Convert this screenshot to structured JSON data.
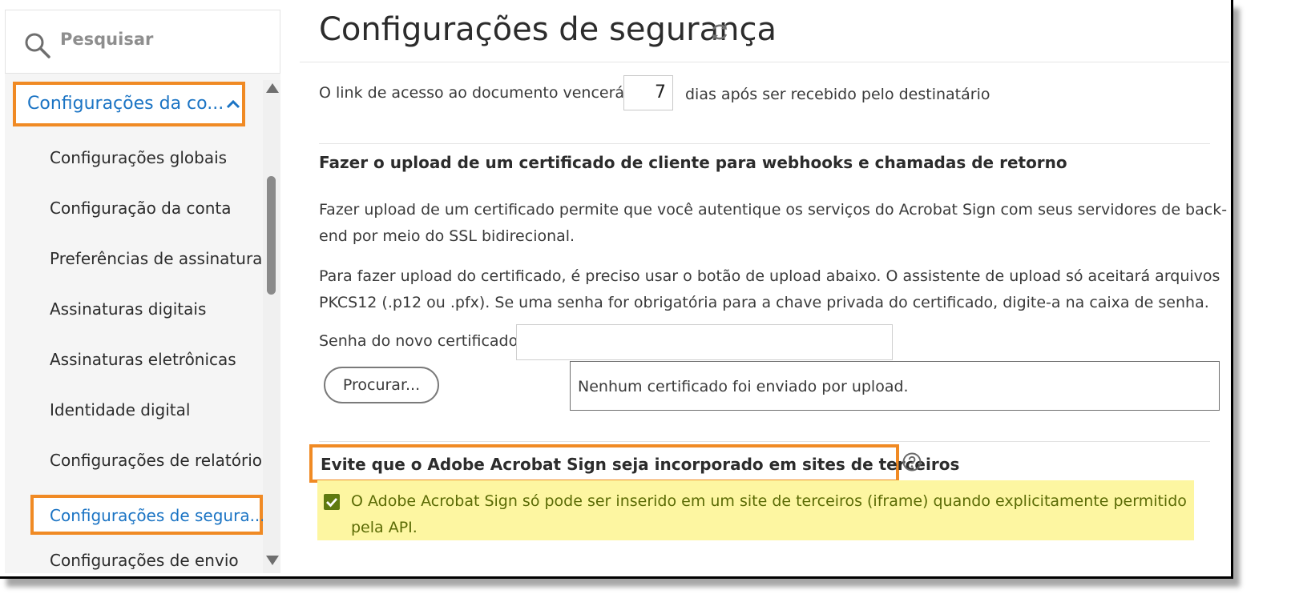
{
  "search": {
    "placeholder": "Pesquisar"
  },
  "sidebar": {
    "group_label": "Configurações da co...",
    "items": [
      {
        "label": "Configurações globais"
      },
      {
        "label": "Configuração da conta"
      },
      {
        "label": "Preferências de assinatura"
      },
      {
        "label": "Assinaturas digitais"
      },
      {
        "label": "Assinaturas eletrônicas"
      },
      {
        "label": "Identidade digital"
      },
      {
        "label": "Configurações de relatório"
      },
      {
        "label": "Configurações de segura..."
      },
      {
        "label": "Configurações de envio"
      }
    ],
    "active_index": 7
  },
  "main": {
    "title": "Configurações de segurança",
    "access_link": {
      "prefix": "O link de acesso ao documento vencerá",
      "days": "7",
      "suffix": "dias após ser recebido pelo destinatário"
    },
    "certificate": {
      "heading": "Fazer o upload de um certificado de cliente para webhooks e chamadas de retorno",
      "para1": "Fazer upload de um certificado permite que você autentique os serviços do Acrobat Sign com seus servidores de back-end por meio do SSL bidirecional.",
      "para2": "Para fazer upload do certificado, é preciso usar o botão de upload abaixo. O assistente de upload só aceitará arquivos PKCS12 (.p12 ou .pfx). Se uma senha for obrigatória para a chave privada do certificado, digite-a na caixa de senha.",
      "password_label": "Senha do novo certificado:",
      "password_value": "",
      "browse_label": "Procurar...",
      "status": "Nenhum certificado foi enviado por upload."
    },
    "embedding": {
      "heading": "Evite que o Adobe Acrobat Sign seja incorporado em sites de terceiros",
      "checkbox_checked": true,
      "checkbox_label": "O Adobe Acrobat Sign só pode ser inserido em um site de terceiros (iframe) quando explicitamente permitido pela API."
    }
  },
  "colors": {
    "accent_blue": "#1b74c4",
    "highlight_orange": "#f08a24",
    "highlight_yellow": "#fdf6a1",
    "checkbox_green": "#5f7a10"
  }
}
